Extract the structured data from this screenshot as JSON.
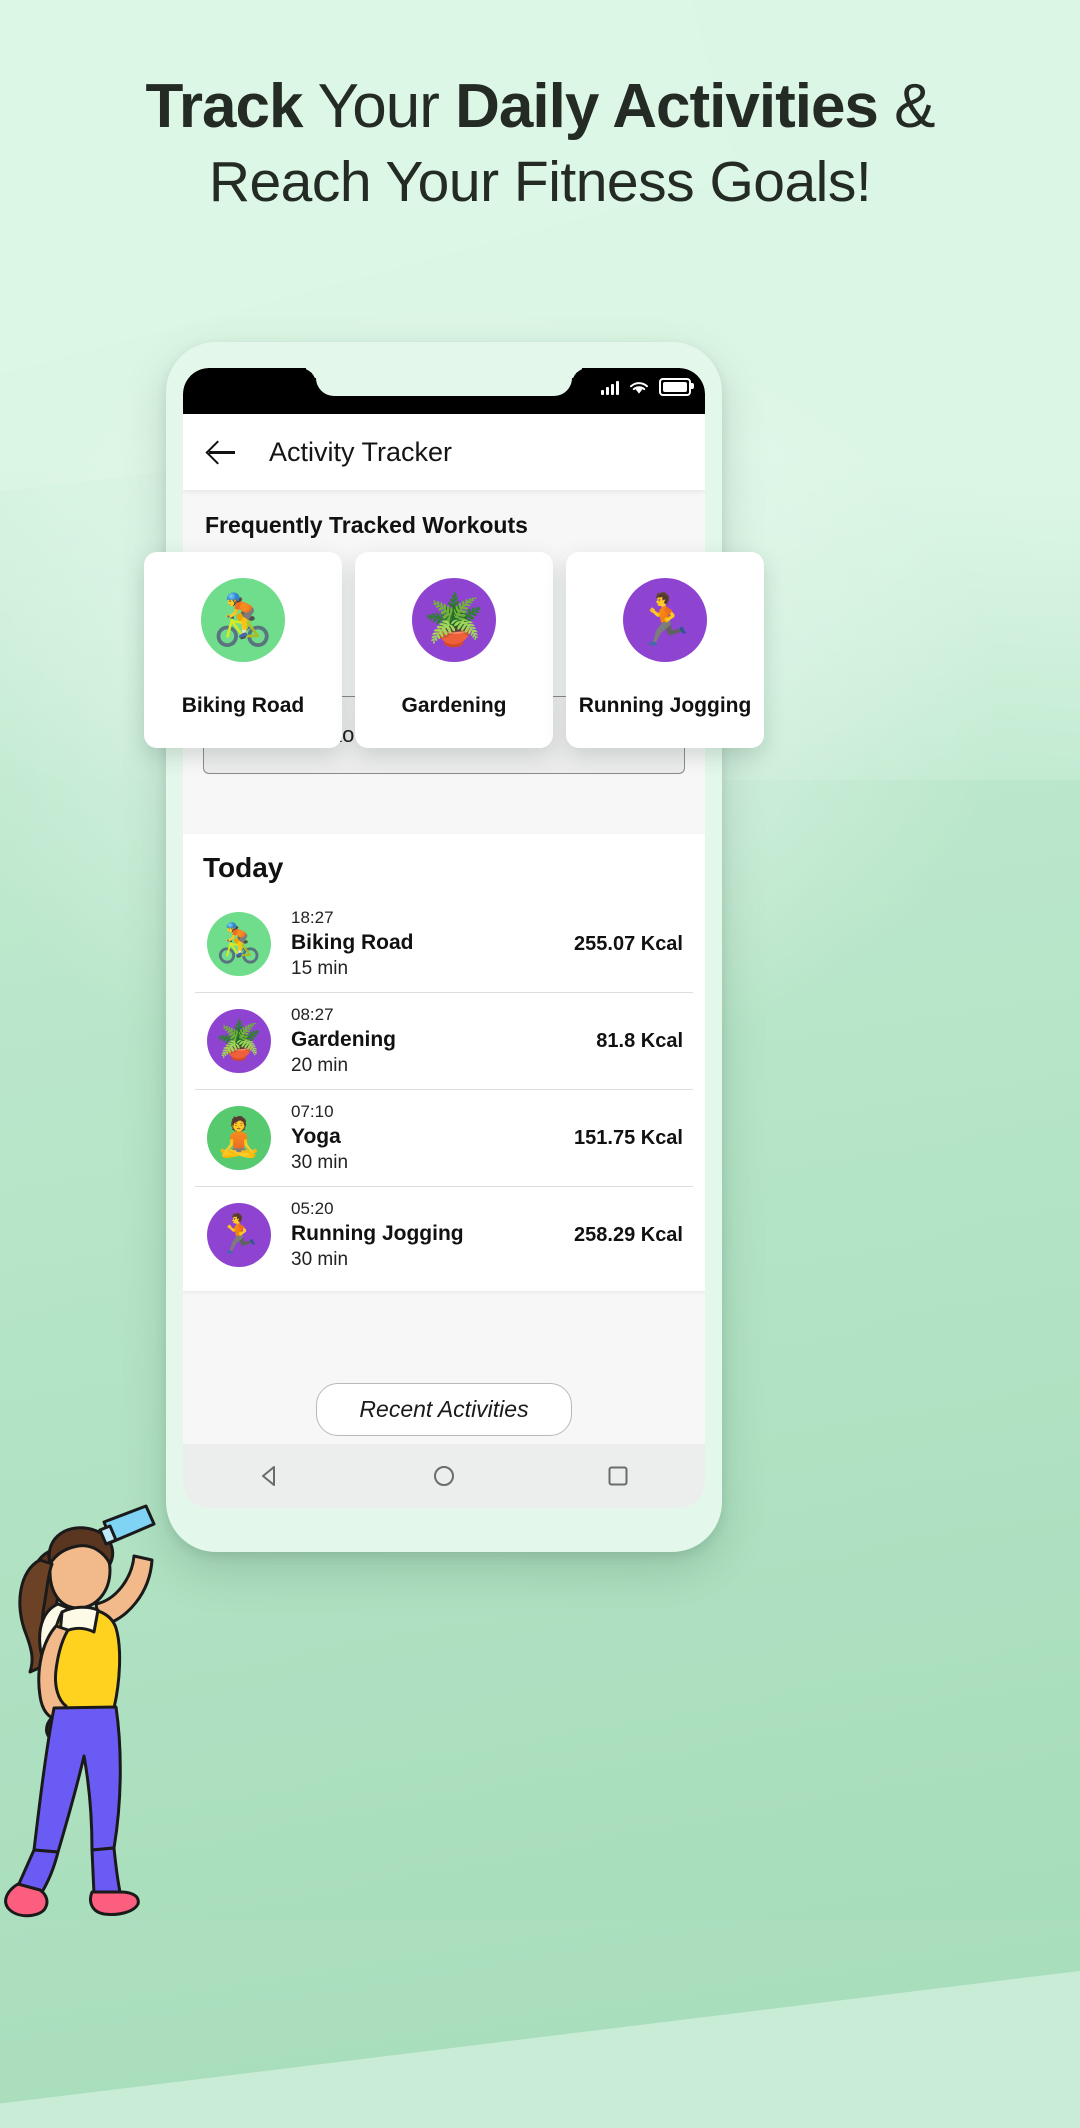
{
  "headline": {
    "line1_part1": "Track",
    "line1_part2": "Your",
    "line1_part3": "Daily Activities",
    "line1_part4": "&",
    "line2": "Reach Your Fitness Goals!"
  },
  "statusbar": {
    "signal_icon": "signal-bars-icon",
    "wifi_icon": "wifi-icon",
    "battery_icon": "battery-icon"
  },
  "appbar": {
    "back_icon": "back-arrow-icon",
    "title": "Activity Tracker"
  },
  "section": {
    "frequent_title": "Frequently Tracked Workouts"
  },
  "workout_cards": [
    {
      "label": "Biking Road",
      "emoji": "🚴",
      "color": "#6fdd8b",
      "icon_name": "biking-icon"
    },
    {
      "label": "Gardening",
      "emoji": "🪴",
      "color": "#8e44d0",
      "icon_name": "gardening-icon"
    },
    {
      "label": "Running Jogging",
      "emoji": "🏃",
      "color": "#8e44d0",
      "icon_name": "running-icon"
    }
  ],
  "select": {
    "value": "Select Workout Activity",
    "caret_icon": "chevron-down-icon"
  },
  "today": {
    "title": "Today",
    "rows": [
      {
        "time": "18:27",
        "name": "Biking Road",
        "duration": "15 min",
        "kcal": "255.07 Kcal",
        "emoji": "🚴",
        "color": "#6fdd8b",
        "icon_name": "biking-icon"
      },
      {
        "time": "08:27",
        "name": "Gardening",
        "duration": "20 min",
        "kcal": "81.8 Kcal",
        "emoji": "🪴",
        "color": "#8e44d0",
        "icon_name": "gardening-icon"
      },
      {
        "time": "07:10",
        "name": "Yoga",
        "duration": "30 min",
        "kcal": "151.75 Kcal",
        "emoji": "🧘",
        "color": "#57c96f",
        "icon_name": "yoga-icon"
      },
      {
        "time": "05:20",
        "name": "Running Jogging",
        "duration": "30 min",
        "kcal": "258.29 Kcal",
        "emoji": "🏃",
        "color": "#8e44d0",
        "icon_name": "running-icon"
      }
    ]
  },
  "footer": {
    "recent_label": "Recent Activities"
  },
  "navbar": {
    "back_icon": "nav-back-triangle-icon",
    "home_icon": "nav-home-circle-icon",
    "recents_icon": "nav-recents-square-icon"
  },
  "colors": {
    "background_top": "#d9f5e3",
    "background_bottom": "#a9dfbe",
    "accent_green": "#6fdd8b",
    "accent_purple": "#8e44d0",
    "text_dark": "#242b25"
  }
}
